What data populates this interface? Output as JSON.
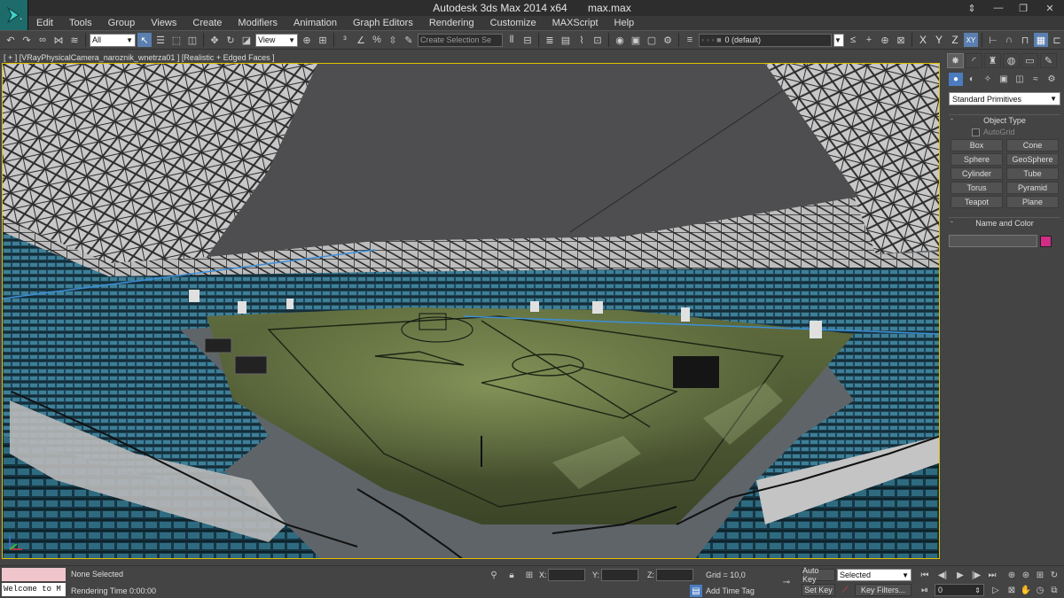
{
  "window": {
    "app_title": "Autodesk 3ds Max  2014 x64",
    "file_name": "max.max",
    "icons": [
      "app-logo-icon",
      "restore-icon",
      "minimize-icon",
      "maximize-icon",
      "close-icon"
    ]
  },
  "menu": [
    "Edit",
    "Tools",
    "Group",
    "Views",
    "Create",
    "Modifiers",
    "Animation",
    "Graph Editors",
    "Rendering",
    "Customize",
    "MAXScript",
    "Help"
  ],
  "toolbar": {
    "selection_filter": "All",
    "reference_coord": "View",
    "named_selection_placeholder": "Create Selection Se",
    "layer_name": "0 (default)",
    "axis_x": "X",
    "axis_y": "Y",
    "axis_z": "Z",
    "axis_xy": "XY"
  },
  "viewport": {
    "label": "[ + ] [VRayPhysicalCamera_naroznik_wnetrza01 ] [Realistic + Edged Faces ]",
    "active_border_color": "#e2c000"
  },
  "command_panel": {
    "category_dropdown": "Standard Primitives",
    "object_type_title": "Object Type",
    "autogrid_label": "AutoGrid",
    "primitives": [
      "Box",
      "Cone",
      "Sphere",
      "GeoSphere",
      "Cylinder",
      "Tube",
      "Torus",
      "Pyramid",
      "Teapot",
      "Plane"
    ],
    "name_color_title": "Name and Color",
    "object_color": "#d22c86"
  },
  "status": {
    "maxscript_text": "Welcome to M",
    "selection_status": "None Selected",
    "render_time": "Rendering Time  0:00:00",
    "x_label": "X:",
    "y_label": "Y:",
    "z_label": "Z:",
    "grid": "Grid = 10,0",
    "add_time_tag": "Add Time Tag",
    "auto_key": "Auto Key",
    "set_key": "Set Key",
    "selected_dropdown": "Selected",
    "key_filters": "Key Filters...",
    "current_frame": "0"
  }
}
